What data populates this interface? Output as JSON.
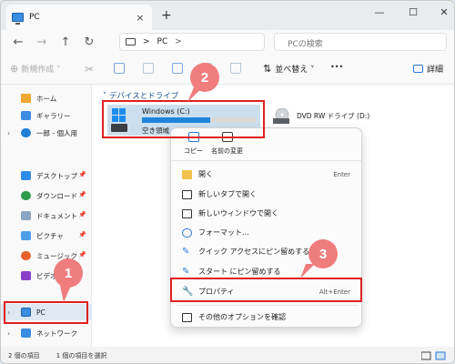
{
  "window": {
    "tab_title": "PC",
    "new_tab": "+",
    "minimize": "—",
    "maximize": "☐",
    "close": "✕"
  },
  "address": {
    "root_sep": ">",
    "segment": "PC",
    "tail_sep": ">"
  },
  "search": {
    "placeholder": "PCの検索"
  },
  "toolbar": {
    "new_label": "新規作成 ˅",
    "sort_label": "並べ替え ˅",
    "more": "•••",
    "details_label": "詳細"
  },
  "sidebar": {
    "items": [
      {
        "label": "ホーム"
      },
      {
        "label": "ギャラリー"
      },
      {
        "label": "一郎 - 個人用"
      },
      {
        "label": "デスクトップ"
      },
      {
        "label": "ダウンロード"
      },
      {
        "label": "ドキュメント"
      },
      {
        "label": "ピクチャ"
      },
      {
        "label": "ミュージック"
      },
      {
        "label": "ビデオ"
      },
      {
        "label": "PC"
      },
      {
        "label": "ネットワーク"
      }
    ]
  },
  "main": {
    "group_header": "˅ デバイスとドライブ",
    "drive_c": {
      "name": "Windows (C:)",
      "free_label": "空き領域",
      "usage_fraction": 0.6
    },
    "dvd": {
      "name": "DVD RW ドライブ (D:)"
    }
  },
  "context_menu": {
    "top": [
      {
        "label": "コピー"
      },
      {
        "label": "名前の変更"
      }
    ],
    "items": [
      {
        "label": "開く",
        "shortcut": "Enter"
      },
      {
        "label": "新しいタブで開く"
      },
      {
        "label": "新しいウィンドウで開く"
      },
      {
        "label": "フォーマット..."
      },
      {
        "label": "クイック アクセスにピン留めする"
      },
      {
        "label": "スタート にピン留めする"
      },
      {
        "label": "プロパティ",
        "shortcut": "Alt+Enter"
      },
      {
        "label": "その他のオプションを確認"
      }
    ]
  },
  "status": {
    "count": "2 個の項目",
    "selected": "1 個の項目を選択"
  },
  "steps": {
    "one": "1",
    "two": "2",
    "three": "3"
  },
  "colors": {
    "accent": "#1d86dc",
    "highlight": "#e02020",
    "badge": "#f07d7d"
  }
}
